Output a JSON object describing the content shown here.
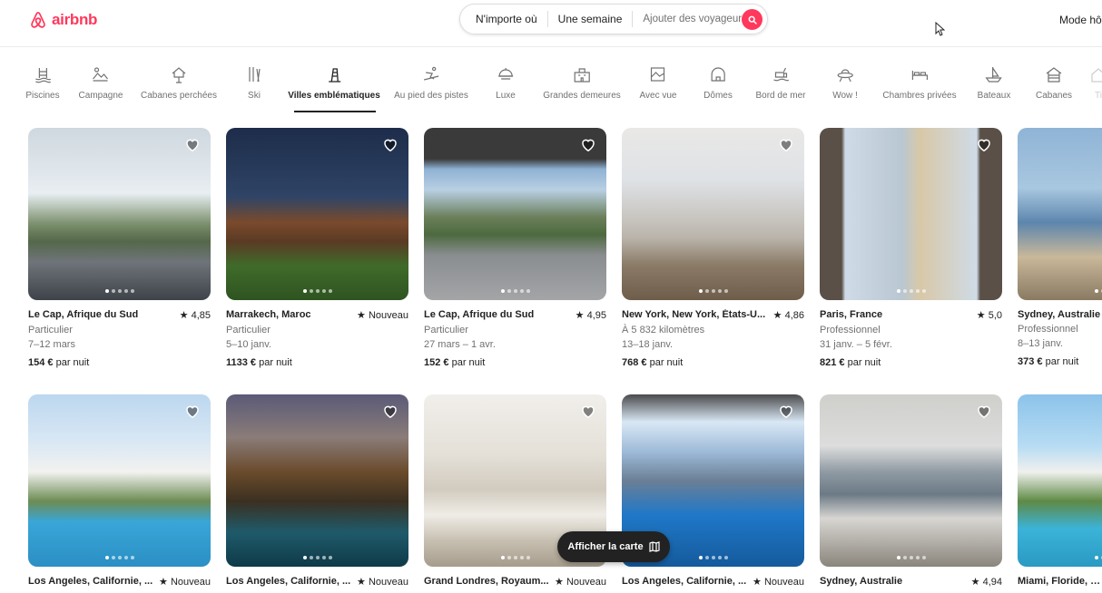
{
  "header": {
    "logo_text": "airbnb",
    "search": {
      "where": "N'importe où",
      "when": "Une semaine",
      "guests_placeholder": "Ajouter des voyageurs"
    },
    "host_mode": "Mode hôt"
  },
  "categories": [
    {
      "label": "Piscines",
      "icon": "pool-icon"
    },
    {
      "label": "Campagne",
      "icon": "countryside-icon"
    },
    {
      "label": "Cabanes perchées",
      "icon": "treehouse-icon"
    },
    {
      "label": "Ski",
      "icon": "ski-icon"
    },
    {
      "label": "Villes emblématiques",
      "icon": "iconic-city-icon",
      "active": true
    },
    {
      "label": "Au pied des pistes",
      "icon": "ski-in-out-icon"
    },
    {
      "label": "Luxe",
      "icon": "luxe-icon"
    },
    {
      "label": "Grandes demeures",
      "icon": "mansion-icon"
    },
    {
      "label": "Avec vue",
      "icon": "view-icon"
    },
    {
      "label": "Dômes",
      "icon": "dome-icon"
    },
    {
      "label": "Bord de mer",
      "icon": "beachfront-icon"
    },
    {
      "label": "Wow !",
      "icon": "ufo-icon"
    },
    {
      "label": "Chambres privées",
      "icon": "bed-icon"
    },
    {
      "label": "Bateaux",
      "icon": "boat-icon"
    },
    {
      "label": "Cabanes",
      "icon": "cabin-icon"
    },
    {
      "label": "Ti",
      "icon": "tiny-home-icon"
    }
  ],
  "listings_row1": [
    {
      "location": "Le Cap, Afrique du Sud",
      "rating": "4,85",
      "host": "Particulier",
      "dates": "7–12 mars",
      "price": "154 €",
      "per": "par nuit"
    },
    {
      "location": "Marrakech, Maroc",
      "rating": "Nouveau",
      "host": "Particulier",
      "dates": "5–10 janv.",
      "price": "1133 €",
      "per": "par nuit"
    },
    {
      "location": "Le Cap, Afrique du Sud",
      "rating": "4,95",
      "host": "Particulier",
      "dates": "27 mars – 1 avr.",
      "price": "152 €",
      "per": "par nuit"
    },
    {
      "location": "New York, New York, États-U...",
      "rating": "4,86",
      "host": "À 5 832 kilomètres",
      "dates": "13–18 janv.",
      "price": "768 €",
      "per": "par nuit"
    },
    {
      "location": "Paris, France",
      "rating": "5,0",
      "host": "Professionnel",
      "dates": "31 janv. – 5 févr.",
      "price": "821 €",
      "per": "par nuit"
    },
    {
      "location": "Sydney, Australie",
      "rating": "",
      "host": "Professionnel",
      "dates": "8–13 janv.",
      "price": "373 €",
      "per": "par nuit"
    }
  ],
  "listings_row2": [
    {
      "location": "Los Angeles, Californie, ...",
      "rating": "Nouveau"
    },
    {
      "location": "Los Angeles, Californie, ...",
      "rating": "Nouveau"
    },
    {
      "location": "Grand Londres, Royaum...",
      "rating": "Nouveau"
    },
    {
      "location": "Los Angeles, Californie, ...",
      "rating": "Nouveau"
    },
    {
      "location": "Sydney, Australie",
      "rating": "4,94"
    },
    {
      "location": "Miami, Floride, États-",
      "rating": ""
    }
  ],
  "map_button": {
    "label": "Afficher la carte"
  },
  "colors": {
    "brand": "#FF385C",
    "text": "#222222",
    "muted": "#717171"
  }
}
